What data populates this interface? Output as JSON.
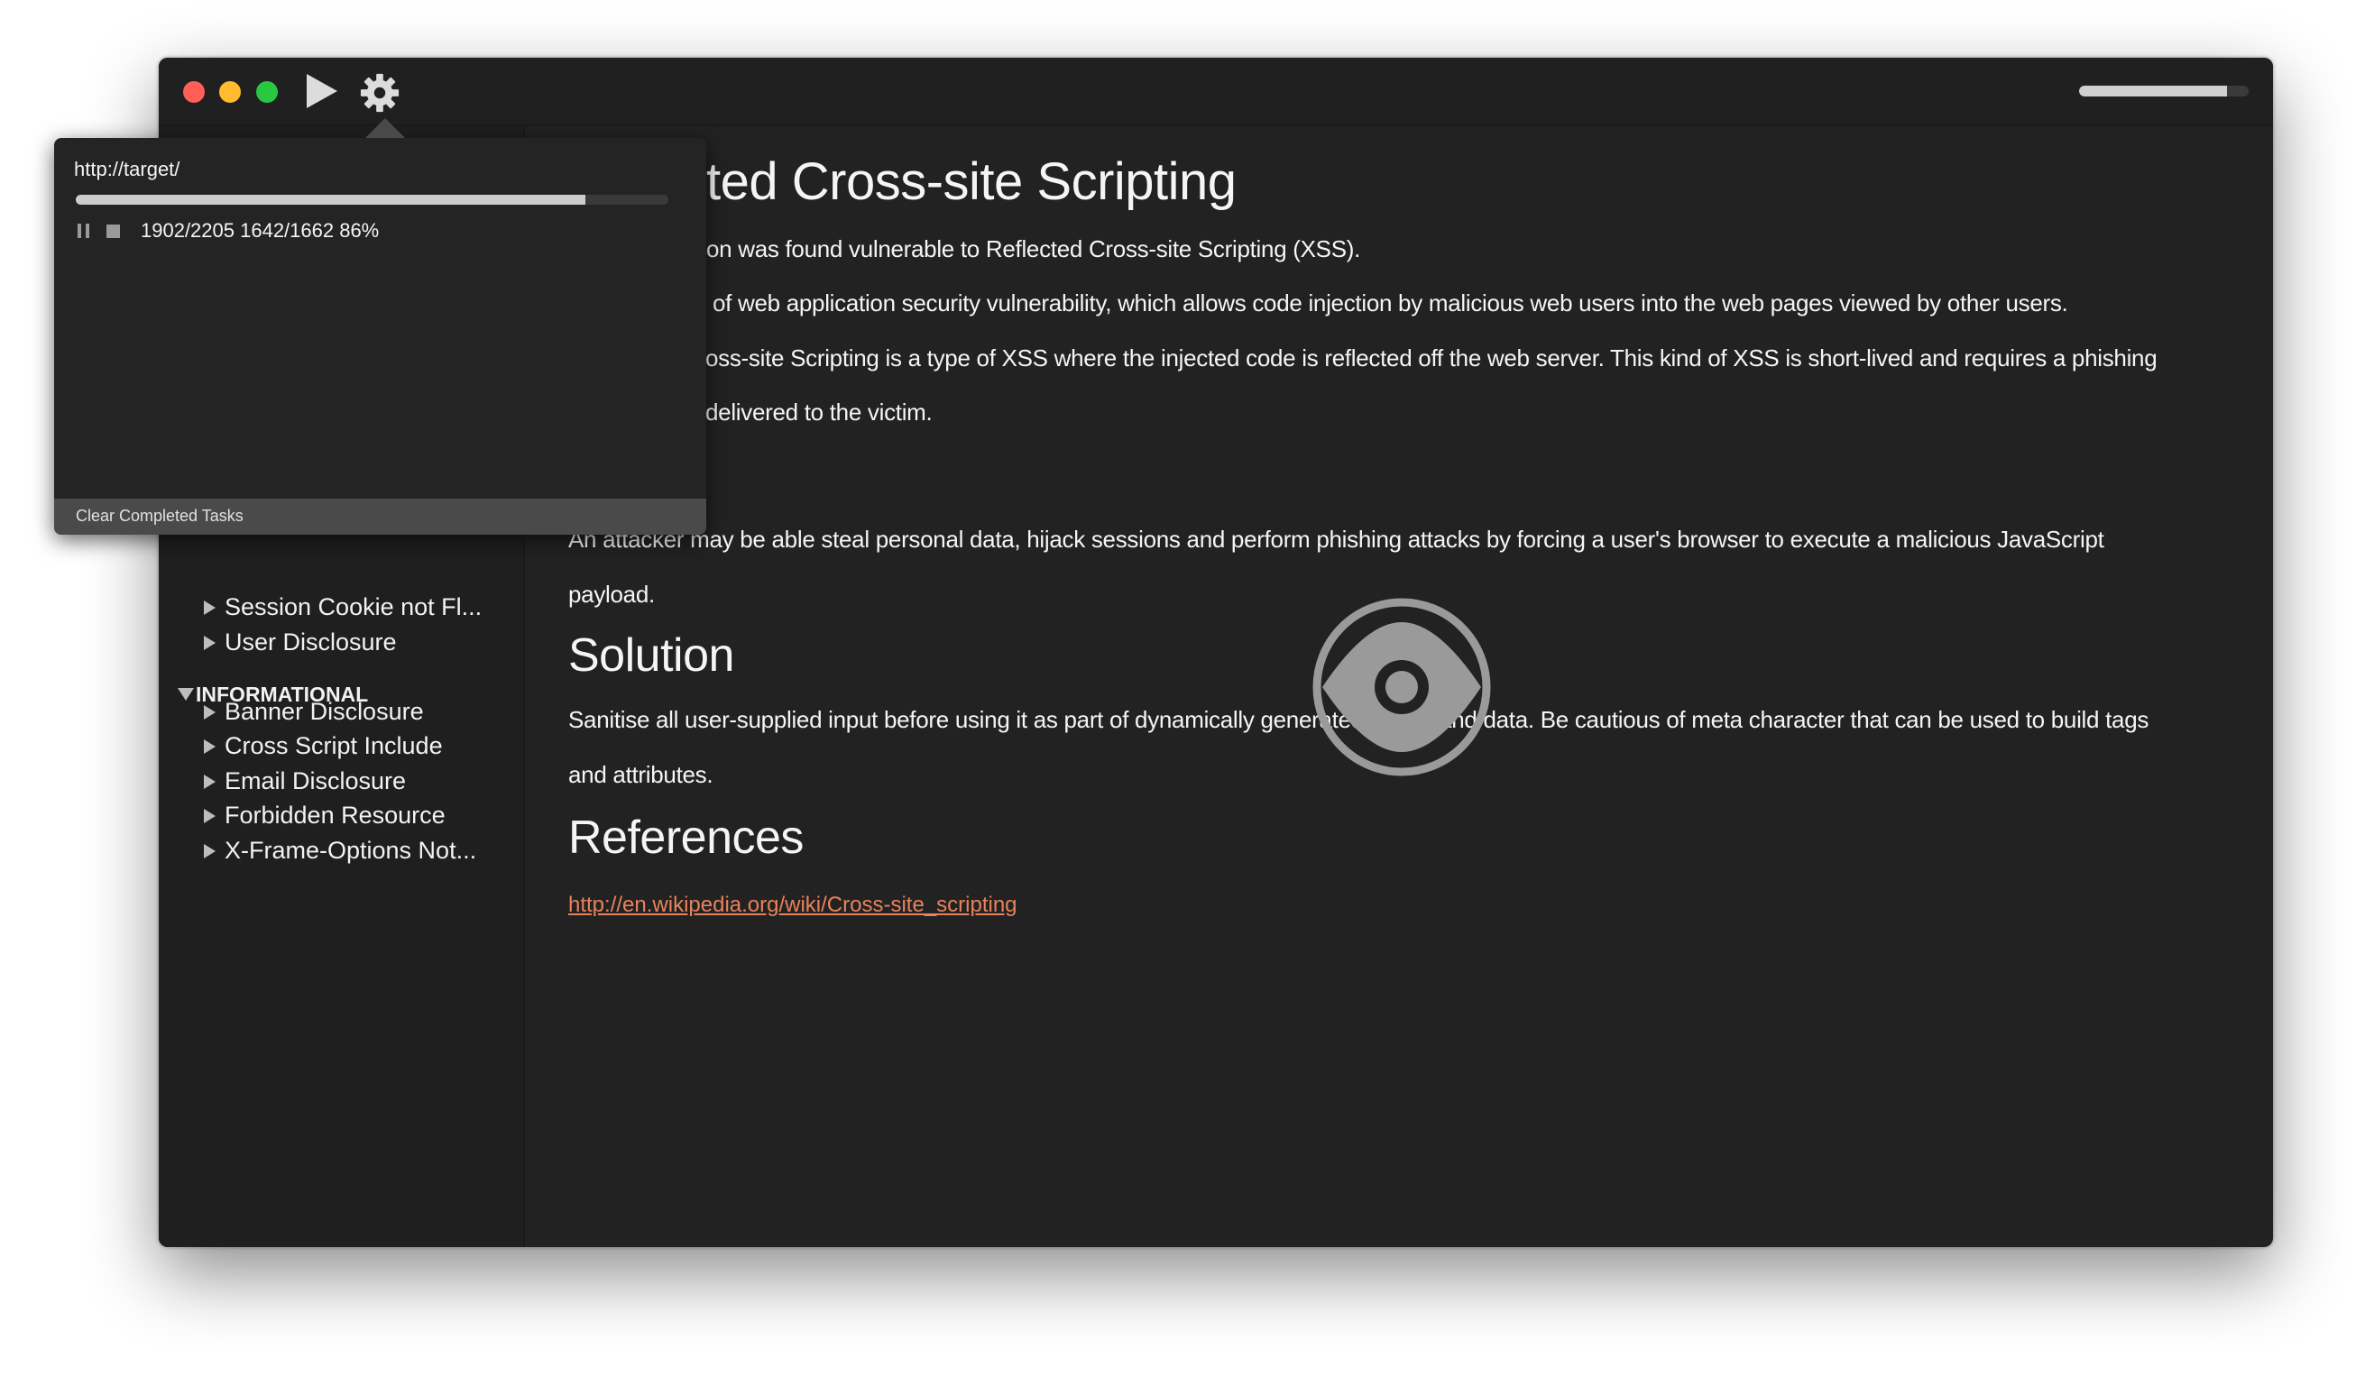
{
  "toolbar": {
    "traffic_lights": {
      "close": "#fe5f57",
      "minimize": "#febc2e",
      "zoom": "#28c840"
    },
    "play_icon": "play-icon",
    "settings_icon": "gear-icon",
    "overall_progress_percent": 87
  },
  "popup": {
    "url": "http://target/",
    "progress_percent": 86,
    "stats": "1902/2205 1642/1662 86%",
    "pause_icon": "pause-icon",
    "stop_icon": "stop-icon",
    "clear_label": "Clear Completed Tasks"
  },
  "sidebar": {
    "items_above": [
      {
        "label": "Session Cookie not Fl..."
      },
      {
        "label": "User Disclosure"
      }
    ],
    "group": {
      "label": "INFORMATIONAL"
    },
    "group_items": [
      {
        "label": "Banner Disclosure"
      },
      {
        "label": "Cross Script Include"
      },
      {
        "label": "Email Disclosure"
      },
      {
        "label": "Forbidden Resource"
      },
      {
        "label": "X-Frame-Options Not..."
      }
    ]
  },
  "main": {
    "title": "ted Cross-site Scripting",
    "lines": [
      "on was found vulnerable to Reflected Cross-site Scripting (XSS).",
      "of web application security vulnerability, which allows code injection by malicious web users into the web pages viewed by other users.",
      "oss-site Scripting is a type of XSS where the injected code is reflected off the web server. This kind of XSS is short-lived and requires a phishing",
      "delivered to the victim."
    ],
    "impact_lines": [
      "An attacker may be able steal personal data, hijack sessions and perform phishing attacks by forcing a user's browser to execute a malicious JavaScript",
      "payload."
    ],
    "solution_heading": "Solution",
    "solution_lines": [
      "Sanitise all user-supplied input before using it as part of dynamically generated pages and data. Be cautious of meta character that can be used to build tags",
      "and attributes."
    ],
    "references_heading": "References",
    "reference_link": "http://en.wikipedia.org/wiki/Cross-site_scripting",
    "link_color": "#e8825a",
    "overlay_icon": "eye-icon"
  }
}
